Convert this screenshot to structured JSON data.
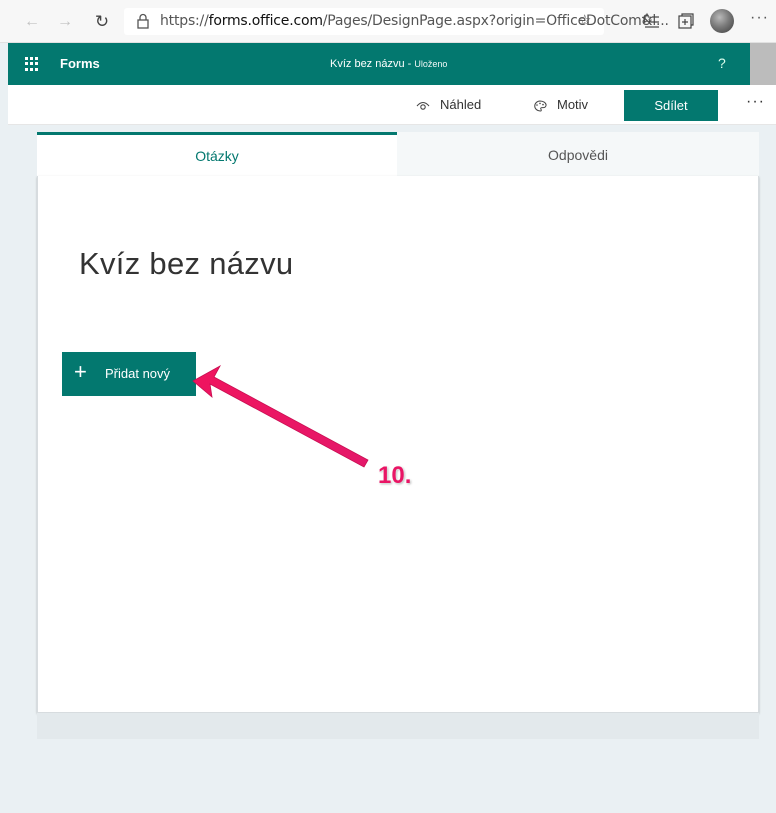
{
  "browser": {
    "url_prefix": "https://",
    "url_domain": "forms.office.com",
    "url_rest": "/Pages/DesignPage.aspx?origin=OfficeDotCom&l...",
    "back_icon": "back-arrow-icon",
    "forward_icon": "forward-arrow-icon",
    "reload_icon": "reload-icon"
  },
  "app": {
    "name": "Forms",
    "doc_title": "Kvíz bez názvu",
    "separator": " - ",
    "save_status": "Uloženo",
    "help": "?"
  },
  "toolbar": {
    "preview_label": "Náhled",
    "theme_label": "Motiv",
    "share_label": "Sdílet",
    "more": "···"
  },
  "tabs": [
    {
      "label": "Otázky",
      "active": true
    },
    {
      "label": "Odpovědi",
      "active": false
    }
  ],
  "form": {
    "title": "Kvíz bez názvu",
    "add_button_label": "Přidat nový",
    "add_button_icon": "+"
  },
  "annotation": {
    "step": "10."
  },
  "colors": {
    "accent": "#03786f",
    "annotation": "#e91565"
  }
}
